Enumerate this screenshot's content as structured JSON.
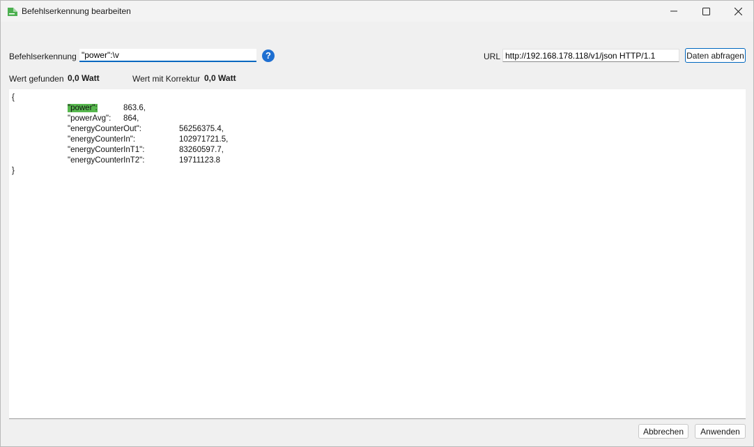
{
  "window": {
    "title": "Befehlserkennung bearbeiten"
  },
  "form": {
    "command_label": "Befehlserkennung",
    "command_value": "\"power\":\\v",
    "url_label": "URL",
    "url_value": "http://192.168.178.118/v1/json HTTP/1.1",
    "fetch_button": "Daten abfragen",
    "found_label": "Wert gefunden",
    "found_value": "0,0 Watt",
    "corrected_label": "Wert mit Korrektur",
    "corrected_value": "0,0 Watt"
  },
  "json_view": {
    "open_brace": "{",
    "close_brace": "}",
    "rows": [
      {
        "key": "\"power\":",
        "value": "863.6,"
      },
      {
        "key": "\"powerAvg\":",
        "value": "864,"
      },
      {
        "key": "\"energyCounterOut\":",
        "value": "56256375.4,"
      },
      {
        "key": "\"energyCounterIn\":",
        "value": "102971721.5,"
      },
      {
        "key": "\"energyCounterInT1\":",
        "value": "83260597.7,"
      },
      {
        "key": "\"energyCounterInT2\":",
        "value": "19711123.8"
      }
    ]
  },
  "footer": {
    "cancel_button": "Abbrechen",
    "apply_button": "Anwenden"
  },
  "colors": {
    "accent": "#0067c0",
    "highlight": "#57b84e",
    "help_icon": "#1e6fd1"
  }
}
